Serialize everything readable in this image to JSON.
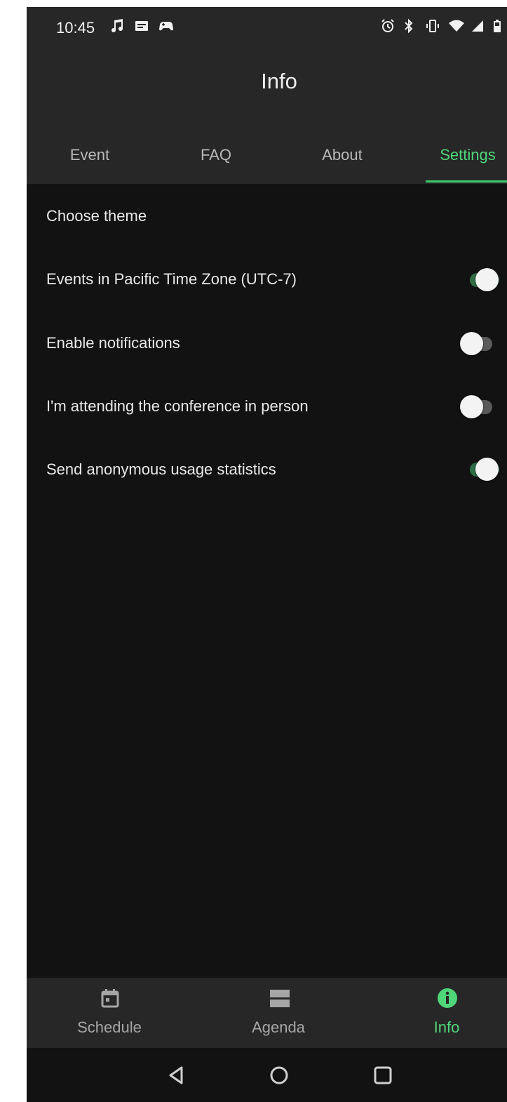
{
  "status_bar": {
    "time": "10:45",
    "left_icons": [
      "music-note-icon",
      "message-icon",
      "game-controller-icon"
    ],
    "right_icons": [
      "alarm-icon",
      "bluetooth-icon",
      "vibrate-icon",
      "wifi-icon",
      "cell-signal-icon",
      "battery-icon"
    ]
  },
  "app_bar": {
    "title": "Info"
  },
  "tabs": [
    {
      "label": "Event",
      "active": false
    },
    {
      "label": "FAQ",
      "active": false
    },
    {
      "label": "About",
      "active": false
    },
    {
      "label": "Settings",
      "active": true
    }
  ],
  "settings": {
    "choose_theme": "Choose theme",
    "items": [
      {
        "label": "Events in Pacific Time Zone (UTC-7)",
        "enabled": true
      },
      {
        "label": "Enable notifications",
        "enabled": false
      },
      {
        "label": "I'm attending the conference in person",
        "enabled": false
      },
      {
        "label": "Send anonymous usage statistics",
        "enabled": true
      }
    ]
  },
  "bottom_nav": [
    {
      "label": "Schedule",
      "icon": "calendar-icon",
      "active": false
    },
    {
      "label": "Agenda",
      "icon": "agenda-icon",
      "active": false
    },
    {
      "label": "Info",
      "icon": "info-icon",
      "active": true
    }
  ],
  "system_nav": [
    "back-icon",
    "home-icon",
    "recents-icon"
  ],
  "colors": {
    "accent": "#4fd67a",
    "background": "#121212",
    "surface": "#272727",
    "toggle_on_track": "#2f6e45"
  }
}
